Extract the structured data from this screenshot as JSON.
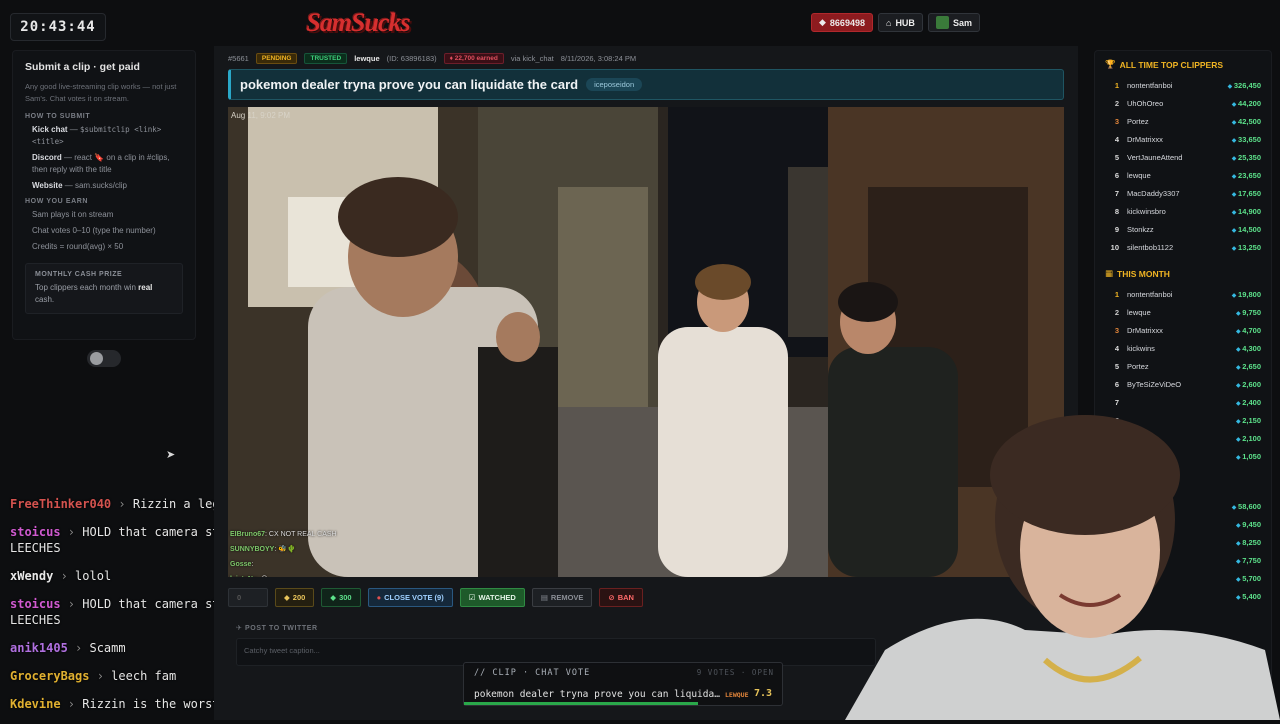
{
  "header": {
    "clock": "20:43:44",
    "logo": "SamSucks",
    "gems_label": "8669498",
    "hub_label": "HUB",
    "user_label": "Sam"
  },
  "left_panel": {
    "title": "Submit a clip · get paid",
    "intro": "Any good live-streaming clip works — not just Sam's. Chat votes it on stream.",
    "how_submit_heading": "HOW TO SUBMIT",
    "kick_label": "Kick chat",
    "kick_text": " — ",
    "kick_cmd": "$submitclip <link> <title>",
    "discord_label": "Discord",
    "discord_text": " — react 🔖 on a clip in #clips, then reply with the title",
    "website_label": "Website",
    "website_text": " — sam.sucks/clip",
    "how_earn_heading": "HOW YOU EARN",
    "earn_1": "Sam plays it on stream",
    "earn_2": "Chat votes 0–10 (type the number)",
    "earn_3": "Credits = round(avg) × 50",
    "prize_title": "MONTHLY CASH PRIZE",
    "prize_text_1": "Top clippers each month win ",
    "prize_bold": "real",
    "prize_text_2": "cash."
  },
  "chat": [
    {
      "user": "FreeThinker040",
      "color": "#d4534f",
      "message": "Rizzin a legend"
    },
    {
      "user": "stoicus",
      "color": "#d05ad0",
      "message": "HOLD that camera steady LEECHES"
    },
    {
      "user": "xWendy",
      "color": "#e8e8e8",
      "message": "lolol"
    },
    {
      "user": "stoicus",
      "color": "#d05ad0",
      "message": "HOLD that camera steady LEECHES"
    },
    {
      "user": "anik1405",
      "color": "#b070e0",
      "message": "Scamm"
    },
    {
      "user": "GroceryBags",
      "color": "#e0b030",
      "message": "leech fam"
    },
    {
      "user": "Kdevine",
      "color": "#e0b030",
      "message": "Rizzin is the worst"
    }
  ],
  "clip": {
    "id": "#5661",
    "status": "PENDING",
    "trust": "TRUSTED",
    "submitter": "lewque",
    "submitter_id": "(ID: 63896183)",
    "earned": "22,700 earned",
    "via": "via kick_chat",
    "date": "8/11/2026, 3:08:24 PM",
    "title": "pokemon dealer tryna prove you can liquidate the card",
    "tag": "iceposeidon",
    "video_timestamp": "Aug 11, 9:02 PM"
  },
  "video_chat": [
    {
      "user": "EIBruno67",
      "text": ": CX NOT REAL CASH"
    },
    {
      "user": "SUNNYBOYY",
      "text": ": 🐝🌵"
    },
    {
      "user": "Gosse",
      "text": ":"
    },
    {
      "user": "leisteNx",
      "text": ": 😆"
    },
    {
      "user": "",
      "text": ""
    },
    {
      "user": "elevenl",
      "text": ""
    },
    {
      "user": "sweetTc",
      "text": ""
    },
    {
      "user": "bhiri",
      "text": ":"
    }
  ],
  "actions": {
    "zero": "0",
    "two_hundred": "200",
    "three_hundred": "300",
    "close_vote": "CLOSE VOTE (9)",
    "watched": "WATCHED",
    "remove": "REMOVE",
    "ban": "BAN"
  },
  "tweet": {
    "label": "POST TO TWITTER",
    "placeholder": "Catchy tweet caption..."
  },
  "leaderboard": {
    "all_time_heading": "ALL TIME TOP CLIPPERS",
    "all_time": [
      {
        "rank": "1",
        "name": "nontentfanboi",
        "value": "326,450"
      },
      {
        "rank": "2",
        "name": "UhOhOreo",
        "value": "44,200"
      },
      {
        "rank": "3",
        "name": "Portez",
        "value": "42,500"
      },
      {
        "rank": "4",
        "name": "DrMatrixxx",
        "value": "33,650"
      },
      {
        "rank": "5",
        "name": "VertJauneAttend",
        "value": "25,350"
      },
      {
        "rank": "6",
        "name": "lewque",
        "value": "23,650"
      },
      {
        "rank": "7",
        "name": "MacDaddy3307",
        "value": "17,650"
      },
      {
        "rank": "8",
        "name": "kickwinsbro",
        "value": "14,900"
      },
      {
        "rank": "9",
        "name": "Stonkzz",
        "value": "14,500"
      },
      {
        "rank": "10",
        "name": "silentbob1122",
        "value": "13,250"
      }
    ],
    "month_heading": "THIS MONTH",
    "month": [
      {
        "rank": "1",
        "name": "nontentfanboi",
        "value": "19,800"
      },
      {
        "rank": "2",
        "name": "lewque",
        "value": "9,750"
      },
      {
        "rank": "3",
        "name": "DrMatrixxx",
        "value": "4,700"
      },
      {
        "rank": "4",
        "name": "kickwins",
        "value": "4,300"
      },
      {
        "rank": "5",
        "name": "Portez",
        "value": "2,650"
      },
      {
        "rank": "6",
        "name": "ByTeSiZeViDeO",
        "value": "2,600"
      },
      {
        "rank": "7",
        "name": "",
        "value": "2,400"
      },
      {
        "rank": "8",
        "name": "",
        "value": "2,150"
      },
      {
        "rank": "9",
        "name": "",
        "value": "2,100"
      },
      {
        "rank": "10",
        "name": "",
        "value": "1,050"
      }
    ],
    "extra_values": [
      "58,600",
      "9,450",
      "8,250",
      "7,750",
      "5,700",
      "5,400"
    ]
  },
  "vote": {
    "heading": "// CLIP · CHAT VOTE",
    "status": "9 VOTES · OPEN",
    "title": "pokemon dealer tryna prove you can liquida…",
    "user": "LEWQUE",
    "score": "7.3",
    "progress": 0.73
  }
}
